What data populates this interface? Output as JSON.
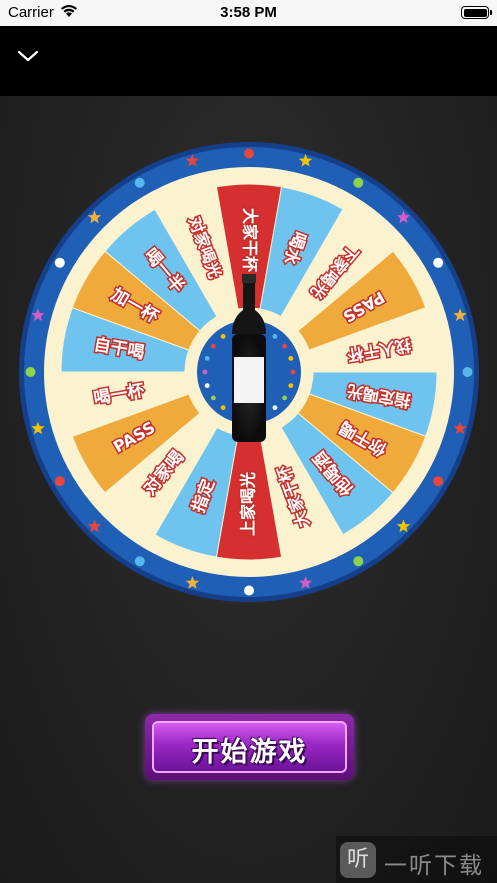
{
  "status_bar": {
    "carrier": "Carrier",
    "time": "3:58 PM"
  },
  "nav": {
    "back_icon": "chevron-down-icon"
  },
  "wheel": {
    "segments": [
      {
        "label": "大家干杯",
        "color": "#d62f2f"
      },
      {
        "label": "喝水",
        "color": "#6ec4ef"
      },
      {
        "label": "下家喝光",
        "color": "#fbf2d0"
      },
      {
        "label": "PASS",
        "color": "#f0aa3c"
      },
      {
        "label": "找人干杯",
        "color": "#fbf2d0"
      },
      {
        "label": "指定喝光",
        "color": "#6ec4ef"
      },
      {
        "label": "你干喝",
        "color": "#f0aa3c"
      },
      {
        "label": "他喝酒",
        "color": "#6ec4ef"
      },
      {
        "label": "大家干杯",
        "color": "#fbf2d0"
      },
      {
        "label": "上家喝光",
        "color": "#d62f2f"
      },
      {
        "label": "指定",
        "color": "#6ec4ef"
      },
      {
        "label": "对家喝",
        "color": "#fbf2d0"
      },
      {
        "label": "PASS",
        "color": "#f0aa3c"
      },
      {
        "label": "喝一杯",
        "color": "#fbf2d0"
      },
      {
        "label": "自干喝",
        "color": "#6ec4ef"
      },
      {
        "label": "加一杯",
        "color": "#f0aa3c"
      },
      {
        "label": "喝一半",
        "color": "#6ec4ef"
      },
      {
        "label": "对家喝光",
        "color": "#fbf2d0"
      }
    ],
    "rim_color": "#1f5fb5",
    "center_icon": "wine-bottle-icon"
  },
  "start_button": {
    "label": "开始游戏"
  },
  "watermark": {
    "logo": "听",
    "text": "一听下载"
  }
}
